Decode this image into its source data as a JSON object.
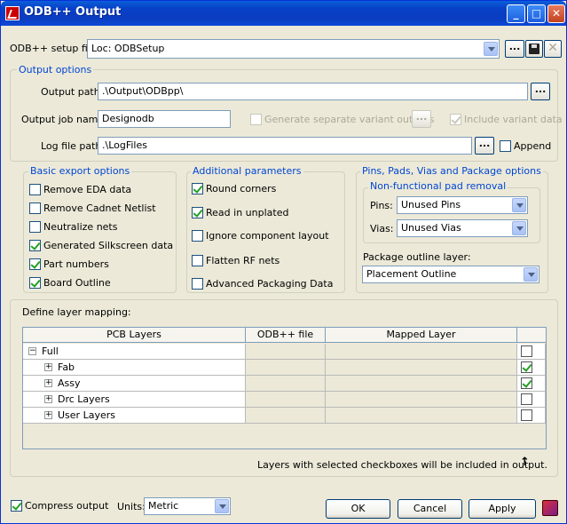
{
  "window": {
    "title": "ODB++ Output"
  },
  "setup": {
    "label": "ODB++ setup file:",
    "value": "Loc: ODBSetup",
    "browse": "..."
  },
  "output_options": {
    "title": "Output options",
    "path_label": "Output path:",
    "path_value": ".\\Output\\ODBpp\\",
    "job_label": "Output job name:",
    "job_value": "Designodb",
    "separate_variant_label": "Generate separate variant outputs",
    "include_variant_label": "Include variant data",
    "log_label": "Log file path:",
    "log_value": ".\\LogFiles",
    "append_label": "Append",
    "browse": "..."
  },
  "basic": {
    "title": "Basic export options",
    "items": [
      {
        "label": "Remove EDA data",
        "checked": false
      },
      {
        "label": "Remove Cadnet Netlist",
        "checked": false
      },
      {
        "label": "Neutralize nets",
        "checked": false
      },
      {
        "label": "Generated Silkscreen data",
        "checked": true
      },
      {
        "label": "Part numbers",
        "checked": true
      },
      {
        "label": "Board Outline",
        "checked": true
      }
    ]
  },
  "additional": {
    "title": "Additional parameters",
    "items": [
      {
        "label": "Round corners",
        "checked": true
      },
      {
        "label": "Read in unplated",
        "checked": true
      },
      {
        "label": "Ignore component layout",
        "checked": false
      },
      {
        "label": "Flatten RF nets",
        "checked": false
      },
      {
        "label": "Advanced Packaging Data",
        "checked": false
      }
    ]
  },
  "pins": {
    "title": "Pins, Pads, Vias and Package options",
    "nfp_title": "Non-functional pad removal",
    "pins_label": "Pins:",
    "pins_value": "Unused Pins",
    "vias_label": "Vias:",
    "vias_value": "Unused Vias",
    "outline_label": "Package outline layer:",
    "outline_value": "Placement Outline"
  },
  "mapping": {
    "title": "Define layer mapping:",
    "columns": [
      "PCB Layers",
      "ODB++ file",
      "Mapped Layer"
    ],
    "rows": [
      {
        "name": "Full",
        "indent": 0,
        "expander": "−",
        "checked": false
      },
      {
        "name": "Fab",
        "indent": 1,
        "expander": "+",
        "checked": true
      },
      {
        "name": "Assy",
        "indent": 1,
        "expander": "+",
        "checked": true
      },
      {
        "name": "Drc Layers",
        "indent": 1,
        "expander": "+",
        "checked": false
      },
      {
        "name": "User Layers",
        "indent": 1,
        "expander": "+",
        "checked": false
      }
    ],
    "note": "Layers with selected checkboxes will be included in output."
  },
  "footer": {
    "compress_label": "Compress output",
    "compress_checked": true,
    "units_label": "Units:",
    "units_value": "Metric",
    "ok": "OK",
    "cancel": "Cancel",
    "apply": "Apply"
  }
}
